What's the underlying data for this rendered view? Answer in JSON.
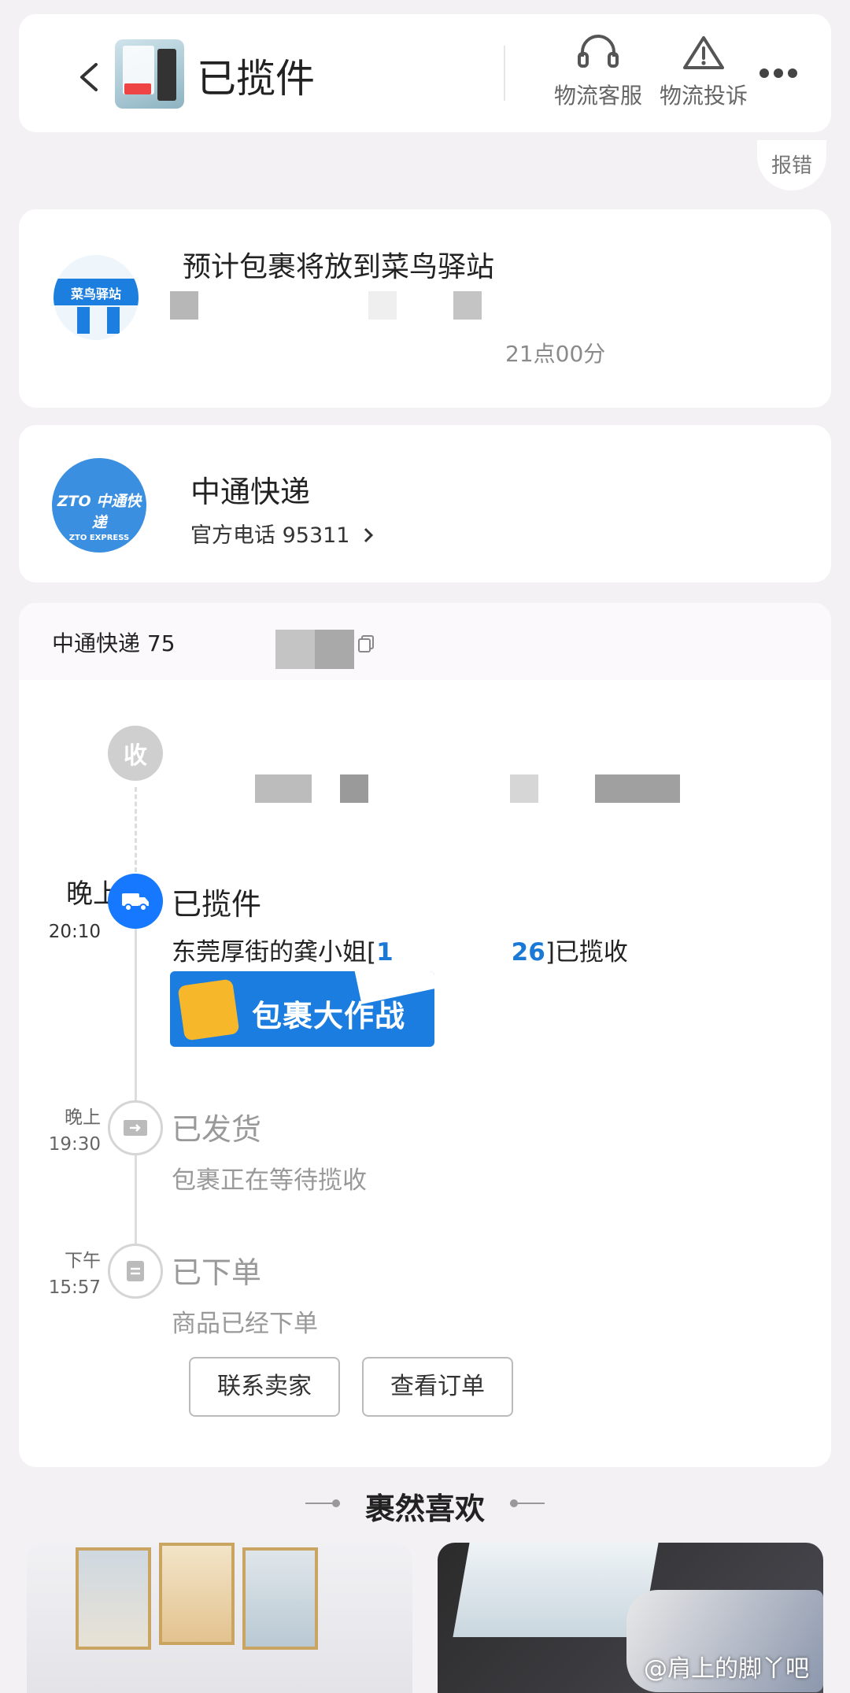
{
  "header": {
    "title": "已揽件",
    "actions": [
      {
        "label": "物流客服",
        "icon": "headset-icon"
      },
      {
        "label": "物流投诉",
        "icon": "warning-icon"
      }
    ],
    "more_icon": "more-icon",
    "report_label": "报错"
  },
  "station": {
    "title": "预计包裹将放到菜鸟驿站",
    "time_text": "21点00分",
    "logo_text": "菜鸟驿站"
  },
  "courier": {
    "name": "中通快递",
    "phone_label": "官方电话 95311",
    "logo_text": "ZTO 中通快递",
    "logo_subtext": "ZTO EXPRESS"
  },
  "tracking": {
    "number_prefix": "中通快递 75",
    "receive_node_text": "收",
    "events": [
      {
        "time_main": "晚上",
        "time_sub": "20:10",
        "title": "已揽件",
        "desc_prefix": "东莞厚街的龚小姐[",
        "desc_phone_start": "1",
        "desc_phone_end": "26",
        "desc_suffix": "]已揽收",
        "active": true
      },
      {
        "time_main": "晚上",
        "time_sub": "19:30",
        "title": "已发货",
        "desc": "包裹正在等待揽收"
      },
      {
        "time_main": "下午",
        "time_sub": "15:57",
        "title": "已下单",
        "desc": "商品已经下单"
      }
    ],
    "banner_text": "包裹大作战",
    "buttons": [
      {
        "label": "联系卖家"
      },
      {
        "label": "查看订单"
      }
    ]
  },
  "recommend": {
    "title": "裹然喜欢",
    "watermark": "@肩上的脚丫吧"
  },
  "colors": {
    "accent_blue": "#1677ff",
    "zto_blue": "#3b8fe0",
    "page_bg": "#f4f1f5"
  }
}
